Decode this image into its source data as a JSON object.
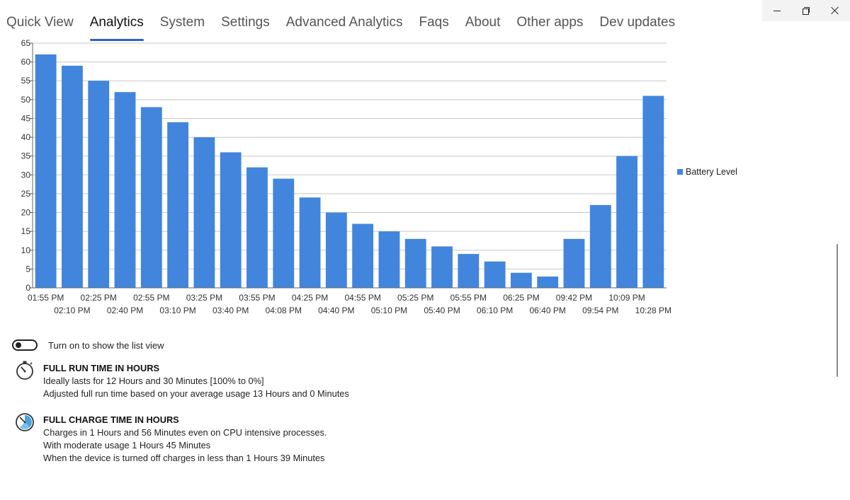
{
  "tabs": [
    {
      "label": "Quick View",
      "active": false
    },
    {
      "label": "Analytics",
      "active": true
    },
    {
      "label": "System",
      "active": false
    },
    {
      "label": "Settings",
      "active": false
    },
    {
      "label": "Advanced Analytics",
      "active": false
    },
    {
      "label": "Faqs",
      "active": false
    },
    {
      "label": "About",
      "active": false
    },
    {
      "label": "Other apps",
      "active": false
    },
    {
      "label": "Dev updates",
      "active": false
    }
  ],
  "window_controls": {
    "icons": [
      "minimize-icon",
      "restore-icon",
      "close-icon"
    ]
  },
  "chart_data": {
    "type": "bar",
    "categories": [
      "01:55 PM",
      "02:10 PM",
      "02:25 PM",
      "02:40 PM",
      "02:55 PM",
      "03:10 PM",
      "03:25 PM",
      "03:40 PM",
      "03:55 PM",
      "04:08 PM",
      "04:25 PM",
      "04:40 PM",
      "04:55 PM",
      "05:10 PM",
      "05:25 PM",
      "05:40 PM",
      "05:55 PM",
      "06:10 PM",
      "06:25 PM",
      "06:40 PM",
      "09:42 PM",
      "09:54 PM",
      "10:09 PM",
      "10:28 PM"
    ],
    "series": [
      {
        "name": "Battery Level",
        "color": "#4285dc",
        "values": [
          62,
          59,
          55,
          52,
          48,
          44,
          40,
          36,
          32,
          29,
          24,
          20,
          17,
          15,
          13,
          11,
          9,
          7,
          4,
          3,
          13,
          22,
          35,
          51
        ]
      }
    ],
    "yticks": [
      0,
      5,
      10,
      15,
      20,
      25,
      30,
      35,
      40,
      45,
      50,
      55,
      60,
      65
    ],
    "ylim": [
      0,
      65
    ],
    "grid": true,
    "legend": "right"
  },
  "list_view": {
    "toggle_on": false,
    "label": "Turn on to show the list view"
  },
  "run_time": {
    "icon": "stopwatch-icon",
    "title": "FULL RUN TIME IN HOURS",
    "line1": "Ideally lasts for 12 Hours and 30 Minutes [100% to 0%]",
    "line2": "Adjusted full run time based on your average usage 13 Hours and 0 Minutes"
  },
  "charge_time": {
    "icon": "timer-icon",
    "title": "FULL CHARGE TIME IN HOURS",
    "line1": "Charges in 1 Hours and 56 Minutes even on CPU intensive processes.",
    "line2": "With moderate usage 1 Hours 45 Minutes",
    "line3": "When the device is turned off charges in less than 1 Hours 39 Minutes"
  }
}
